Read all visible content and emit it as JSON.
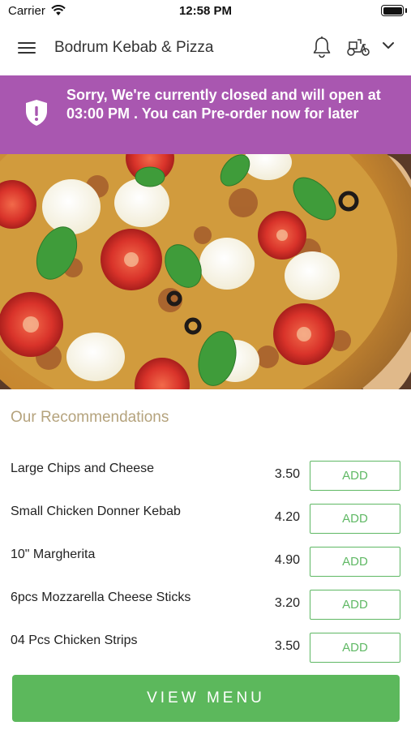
{
  "status_bar": {
    "carrier": "Carrier",
    "time": "12:58 PM"
  },
  "header": {
    "title": "Bodrum Kebab & Pizza",
    "icons": [
      "menu-icon",
      "bell-icon",
      "scooter-icon",
      "chevron-down-icon"
    ]
  },
  "banner": {
    "message": "Sorry, We're currently closed and will open at 03:00 PM . You can Pre-order now for later",
    "color": "#a957b0",
    "icon": "shield-exclamation-icon"
  },
  "recommendations": {
    "title": "Our Recommendations",
    "items": [
      {
        "name": "Large Chips and Cheese",
        "price": "3.50",
        "action": "ADD"
      },
      {
        "name": "Small Chicken Donner Kebab",
        "price": "4.20",
        "action": "ADD"
      },
      {
        "name": "10\" Margherita",
        "price": "4.90",
        "action": "ADD"
      },
      {
        "name": "6pcs Mozzarella Cheese Sticks",
        "price": "3.20",
        "action": "ADD"
      },
      {
        "name": "04 Pcs Chicken Strips",
        "price": "3.50",
        "action": "ADD"
      }
    ]
  },
  "footer": {
    "view_menu_label": "VIEW MENU",
    "accent": "#5cb85c"
  }
}
